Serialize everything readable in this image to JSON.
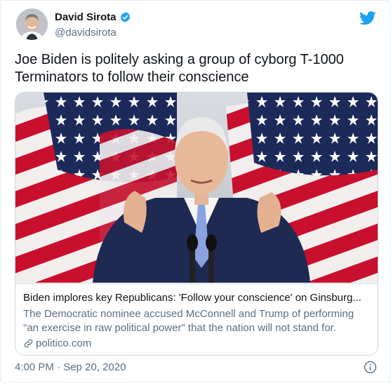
{
  "author": {
    "display_name": "David Sirota",
    "handle": "@davidsirota",
    "verified_icon": "verified-badge-icon"
  },
  "tweet": {
    "text": "Joe Biden is politely asking a group of cyborg T-1000 Terminators to follow their conscience",
    "timestamp": "4:00 PM · Sep 20, 2020"
  },
  "card": {
    "image_icon": "photo-joe-biden-speaking-at-podium-with-flags",
    "title": "Biden implores key Republicans: 'Follow your conscience' on Ginsburg...",
    "description": "The Democratic nominee accused McConnell and Trump of performing \"an exercise in raw political power\" that the nation will not stand for.",
    "domain": "politico.com"
  },
  "colors": {
    "brand_blue": "#1da1f2",
    "secondary_text": "#5b7083",
    "flag_red": "#c8102e",
    "flag_navy": "#1c2a5a"
  }
}
